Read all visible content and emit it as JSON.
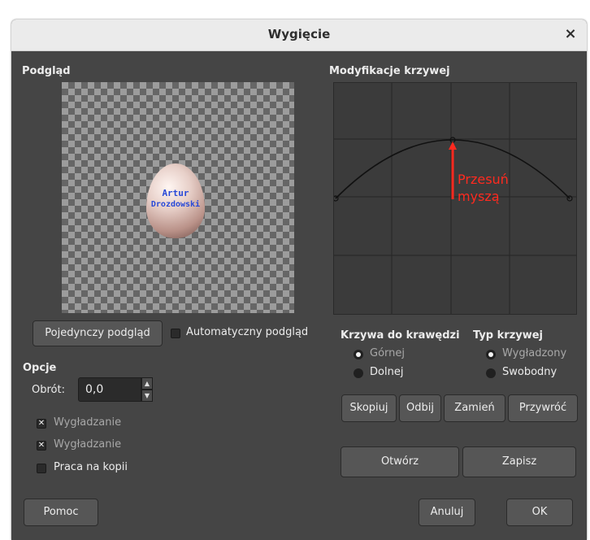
{
  "window": {
    "title": "Wygięcie"
  },
  "preview": {
    "heading": "Podgląd",
    "egg_text": [
      "Artur",
      "Drozdowski"
    ],
    "single_button": "Pojedynczy podgląd",
    "auto_label": "Automatyczny podgląd",
    "auto_checked": false
  },
  "curve": {
    "heading": "Modyfikacje krzywej",
    "annotation": [
      "Przesuń",
      "myszą"
    ],
    "annotation_color": "#ff2a1f"
  },
  "options": {
    "heading": "Opcje",
    "rotation_label": "Obrót:",
    "rotation_value": "0,0",
    "smooth1_label": "Wygładzanie",
    "smooth1_checked": true,
    "smooth2_label": "Wygładzanie",
    "smooth2_checked": true,
    "work_on_copy_label": "Praca na kopii",
    "work_on_copy_checked": false
  },
  "edge": {
    "heading": "Krzywa do krawędzi",
    "upper": "Górnej",
    "lower": "Dolnej",
    "selected": "upper"
  },
  "curve_type": {
    "heading": "Typ krzywej",
    "smooth": "Wygładzony",
    "free": "Swobodny",
    "selected": "smooth"
  },
  "actions": {
    "copy": "Skopiuj",
    "mirror": "Odbij",
    "swap": "Zamień",
    "reset": "Przywróć",
    "open": "Otwórz",
    "save": "Zapisz"
  },
  "footer": {
    "help": "Pomoc",
    "cancel": "Anuluj",
    "ok": "OK"
  },
  "icons": {
    "close": "close-icon",
    "spin_up": "chevron-up-icon",
    "spin_down": "chevron-down-icon",
    "check": "check-icon"
  }
}
